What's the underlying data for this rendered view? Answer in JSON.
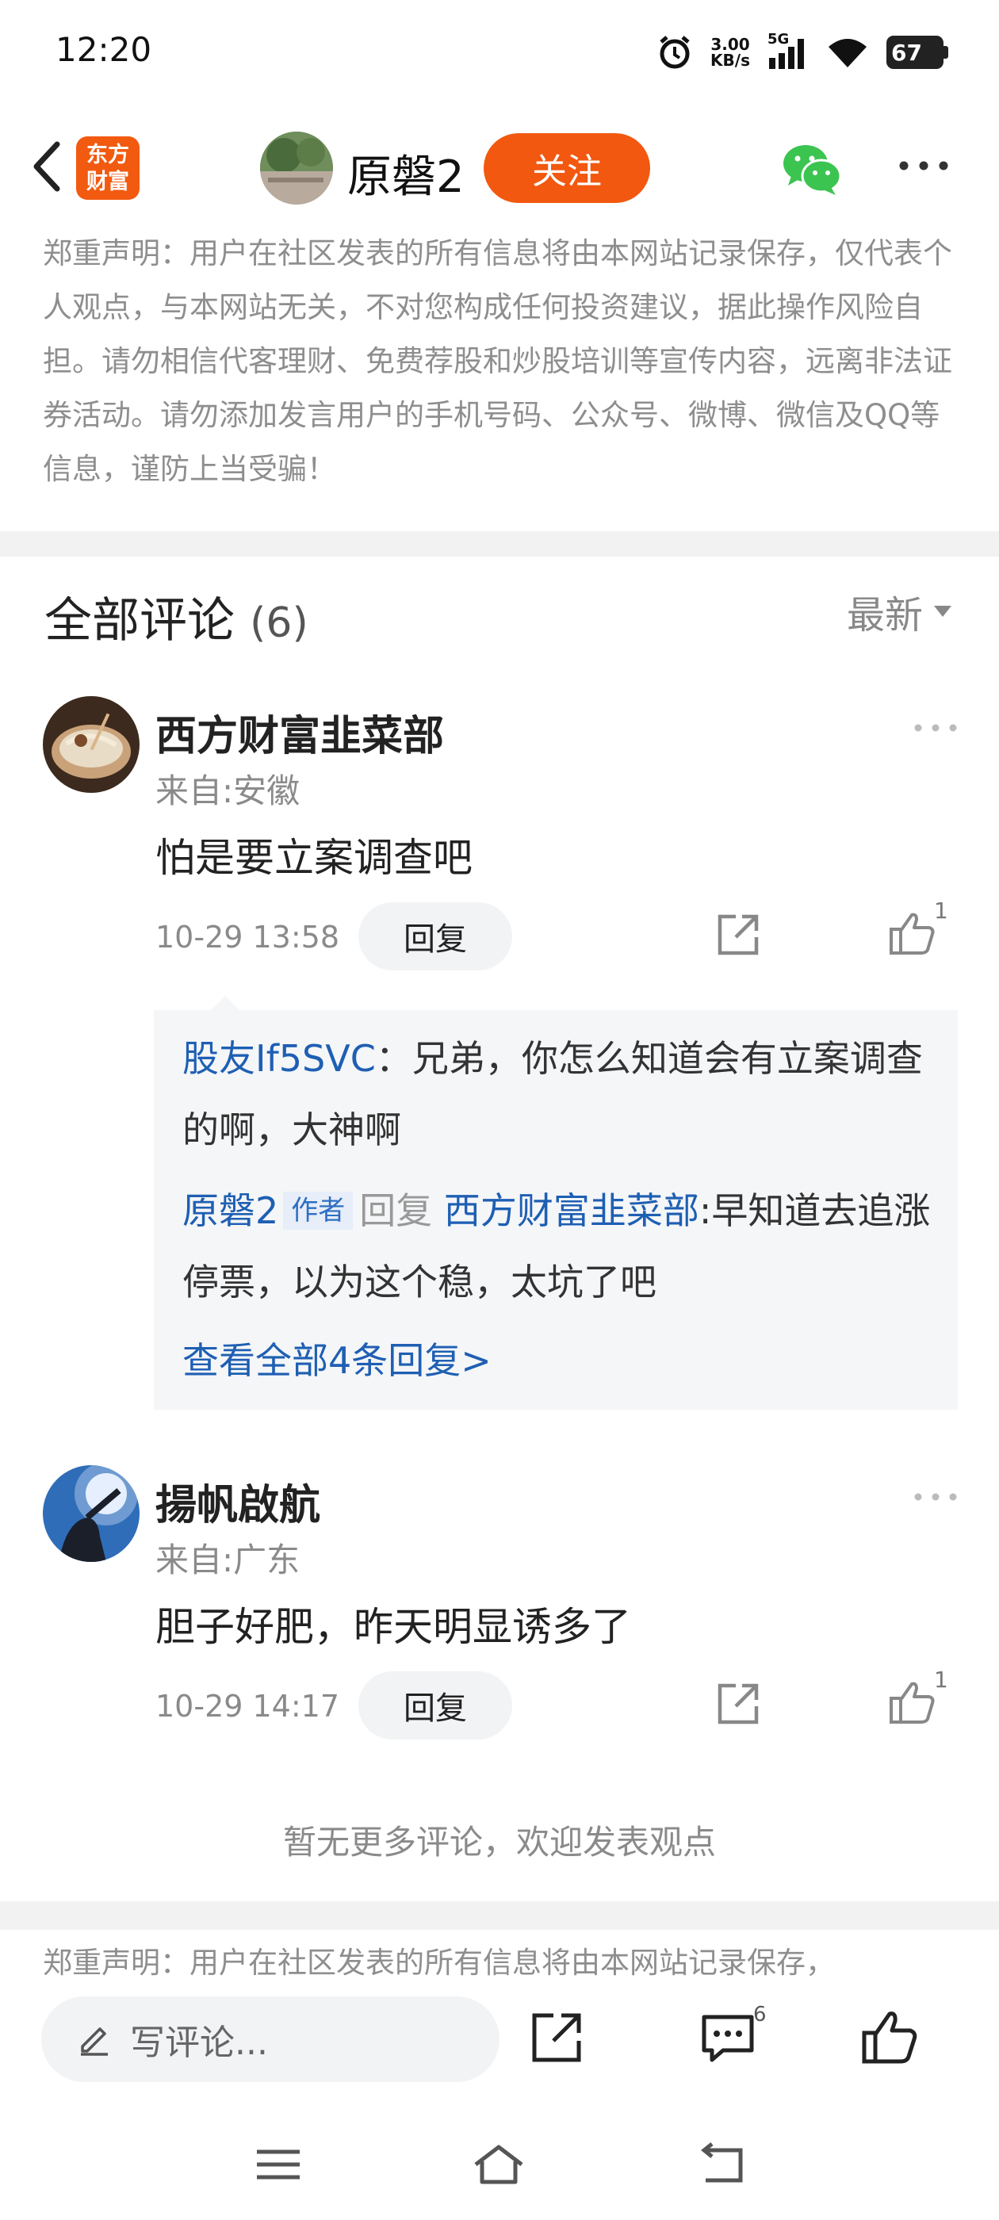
{
  "status_bar": {
    "time": "12:20",
    "net_speed_value": "3.00",
    "net_speed_unit": "KB/s",
    "network": "5G",
    "battery": "67"
  },
  "header": {
    "logo_line1": "东方",
    "logo_line2": "财富",
    "author_name": "原磐2",
    "follow_label": "关注"
  },
  "disclaimer": "郑重声明：用户在社区发表的所有信息将由本网站记录保存，仅代表个人观点，与本网站无关，不对您构成任何投资建议，据此操作风险自担。请勿相信代客理财、免费荐股和炒股培训等宣传内容，远离非法证券活动。请勿添加发言用户的手机号码、公众号、微博、微信及QQ等信息，谨防上当受骗！",
  "comments_header": {
    "title": "全部评论",
    "count": "(6)",
    "sort_label": "最新"
  },
  "comments": [
    {
      "name": "西方财富韭菜部",
      "location": "来自:安徽",
      "text": "怕是要立案调查吧",
      "time": "10-29 13:58",
      "reply_label": "回复",
      "likes": "1",
      "replies": [
        {
          "user": "股友If5SVC",
          "separator": "：",
          "text": "兄弟，你怎么知道会有立案调查的啊，大神啊"
        },
        {
          "user": "原磐2",
          "author_tag": "作者",
          "reply_word": "回复",
          "target": "西方财富韭菜部",
          "separator": ":",
          "text": "早知道去追涨停票，以为这个稳，太坑了吧"
        }
      ],
      "view_all": "查看全部4条回复>"
    },
    {
      "name": "揚帆啟航",
      "location": "来自:广东",
      "text": "胆子好肥，昨天明显诱多了",
      "time": "10-29 14:17",
      "reply_label": "回复",
      "likes": "1"
    }
  ],
  "no_more_text": "暂无更多评论，欢迎发表观点",
  "disclaimer_footer": "郑重声明：用户在社区发表的所有信息将由本网站记录保存，",
  "bottom_bar": {
    "input_placeholder": "写评论...",
    "comment_count": "6"
  },
  "colors": {
    "brand_orange": "#f2580f",
    "link_blue": "#1e5fb3",
    "wechat_green": "#3cc451"
  }
}
